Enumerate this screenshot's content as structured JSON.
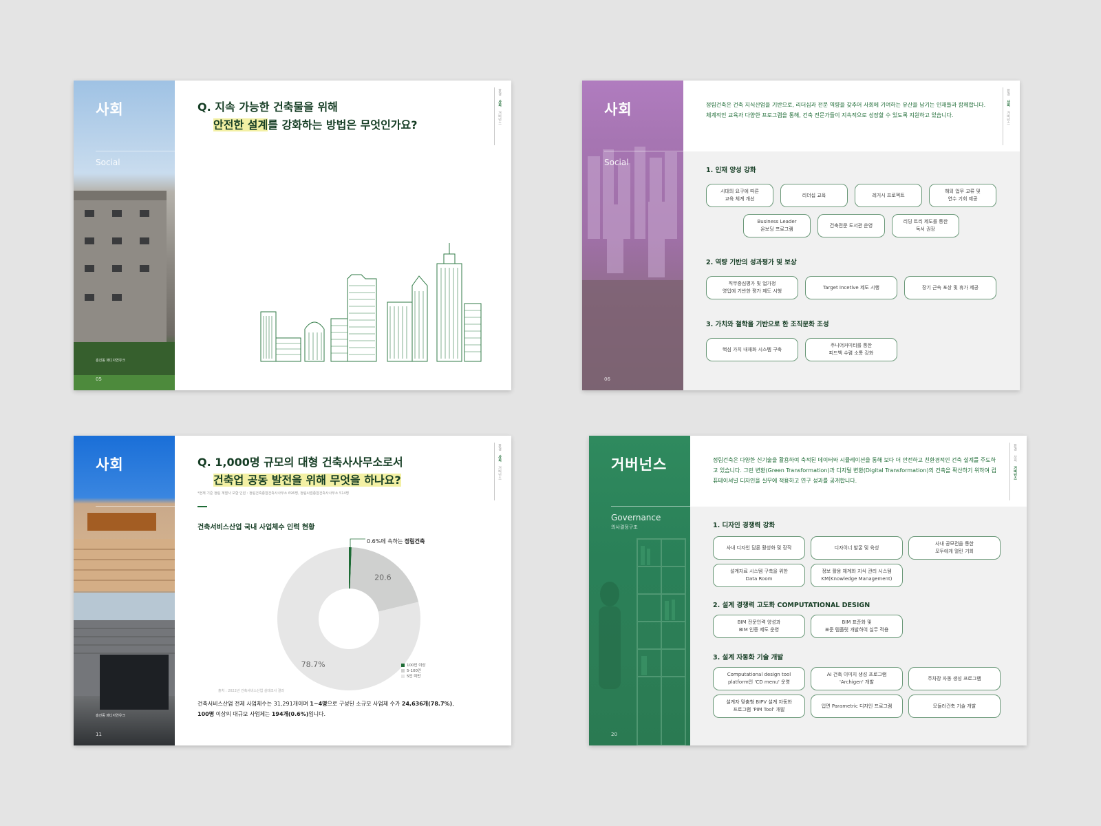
{
  "colors": {
    "brand_green": "#1d6b35",
    "dark_green": "#153d24",
    "highlight": "#f3f0a4",
    "purple": "#a979b4",
    "blue": "#1e6fd6",
    "teal": "#2b8a5c"
  },
  "tabs": [
    "환경",
    "사회",
    "거버넌스"
  ],
  "page1": {
    "side_title": "사회",
    "side_sub": "Social",
    "caption": "홍진동 패디자연유크",
    "page_number": "05",
    "question_line1": "Q. 지속 가능한 건축물을 위해",
    "question_line2_hl": "안전한 설계",
    "question_line2_rest": "를 강화하는 방법은 무엇인가요?"
  },
  "page2": {
    "side_title": "사회",
    "side_sub": "Social",
    "page_number": "06",
    "intro": "정림건축은 건축 지식산업을 기반으로, 리더십과 전문 역량을 갖추어 사회에 기여하는 유산을 남기는 인재들과 함께합니다. 체계적인 교육과 다양한 프로그램을 통해, 건축 전문가들이 지속적으로 성장할 수 있도록 지원하고 있습니다.",
    "sections": [
      {
        "heading": "1. 인재 양성 강화",
        "items": [
          "시대의 요구에 따른\n교육 체계 개선",
          "리더십 교육",
          "레거시 프로젝트",
          "해외 업무 교류 및\n연수 기회 제공",
          "Business Leader\n온보딩 프로그램",
          "건축전문 도서관 운영",
          "리딩 트리 제도를 통한\n독서 권장"
        ]
      },
      {
        "heading": "2. 역량 기반의 성과평가 및 보상",
        "items": [
          "직무중심평가 및 업가정\n영입에 기반한 평가 제도 시행",
          "Target Incetive 제도 시행",
          "장기 근속 포상 및 휴가 제공"
        ]
      },
      {
        "heading": "3. 가치와 철학을 기반으로 한 조직문화 조성",
        "items": [
          "핵심 가치 내재화 시스템 구축",
          "주니어커미티를 통한\n피드백 수렴 소통 강화"
        ]
      }
    ]
  },
  "page3": {
    "side_title": "사회",
    "page_number": "11",
    "caption": "홍진동 패디자연유크",
    "question_line1": "Q. 1,000명 규모의 대형 건축사사무소로서",
    "question_line2": "건축업 공동 발전을 위해 무엇을 하나요?",
    "note": "*현재 기준 정림 계열사 포함 인원 : 정림건축종합건축사사무소 696명, 정림씨엠종합건축사사무소 514명",
    "chart_title": "건축서비스산업 국내 사업체수 인력 현황",
    "callout_pre": "0.6%에 속하는 ",
    "callout_bold": "정림건축",
    "source": "출처 : 2022년 건축서비스산업 실태조사 결과",
    "body_1": "건축서비스산업 전체 사업체수는 31,291개이며 ",
    "body_b1": "1~4명",
    "body_2": "으로 구성된 소규모 사업체 수가 ",
    "body_b2": "24,636개(78.7%)",
    "body_3": ",",
    "body_b3": "100명",
    "body_4": " 이상의 대규모 사업체는 ",
    "body_b4": "194개(0.6%)",
    "body_5": "입니다."
  },
  "chart_data": {
    "type": "pie",
    "title": "건축서비스산업 국내 사업체수 인력 현황",
    "categories": [
      "100인 이상",
      "5-100인",
      "5인 미만"
    ],
    "values": [
      0.6,
      20.6,
      78.7
    ],
    "labels": [
      "",
      "20.6",
      "78.7%"
    ],
    "colors": [
      "#1d6b35",
      "#cfd0cf",
      "#e6e6e6"
    ],
    "legend_position": "bottom-right"
  },
  "page4": {
    "side_title": "거버넌스",
    "side_sub": "Governance",
    "side_sub2": "의사결정구조",
    "page_number": "20",
    "intro": "정림건축은 다양한 신기술을 활용하여 축적된 데이터와 시뮬레이션을 통해 보다 더 안전하고 친환경적인 건축 설계를 주도하고 있습니다. 그린 변환(Green Transformation)과 디지털 변환(Digital Transformation)의 건축을 확산하기 위하여 컴퓨테이셔널 디자인을 실무에 적용하고 연구 성과를 공개합니다.",
    "sections": [
      {
        "heading": "1. 디자인 경쟁력 강화",
        "items": [
          "사내 디자인 담론 활성화 및 장작",
          "디자이너 발굴 및 육성",
          "사내 공모전을 통한\n모두에게 열린 기회",
          "설계자료 시스템 구축을 위한\nData Room",
          "정보 활용 체계화 지식 관리 시스템\nKM(Knowledge Management)"
        ]
      },
      {
        "heading": "2. 설계 경쟁력 고도화 COMPUTATIONAL DESIGN",
        "items": [
          "BIM 전문인력 양성과\nBIM 인증 제도 운영",
          "BIM 표준화 및\n표준 템플릿 개발하여 실무 적용"
        ]
      },
      {
        "heading": "3. 설계 자동화 기술 개발",
        "items": [
          "Computational design tool\nplatform인 'CD menu' 운영",
          "AI 건축 이미지 생성 프로그램\n'Archigen' 개발",
          "주차장 자동 생성 프로그램",
          "설계자 맞춤형 BIPV 설계 자동화\n프로그램 'PIM Tool' 개발",
          "입면 Parametric 디자인 프로그램",
          "모듈러건축 기술 개발"
        ]
      }
    ]
  }
}
